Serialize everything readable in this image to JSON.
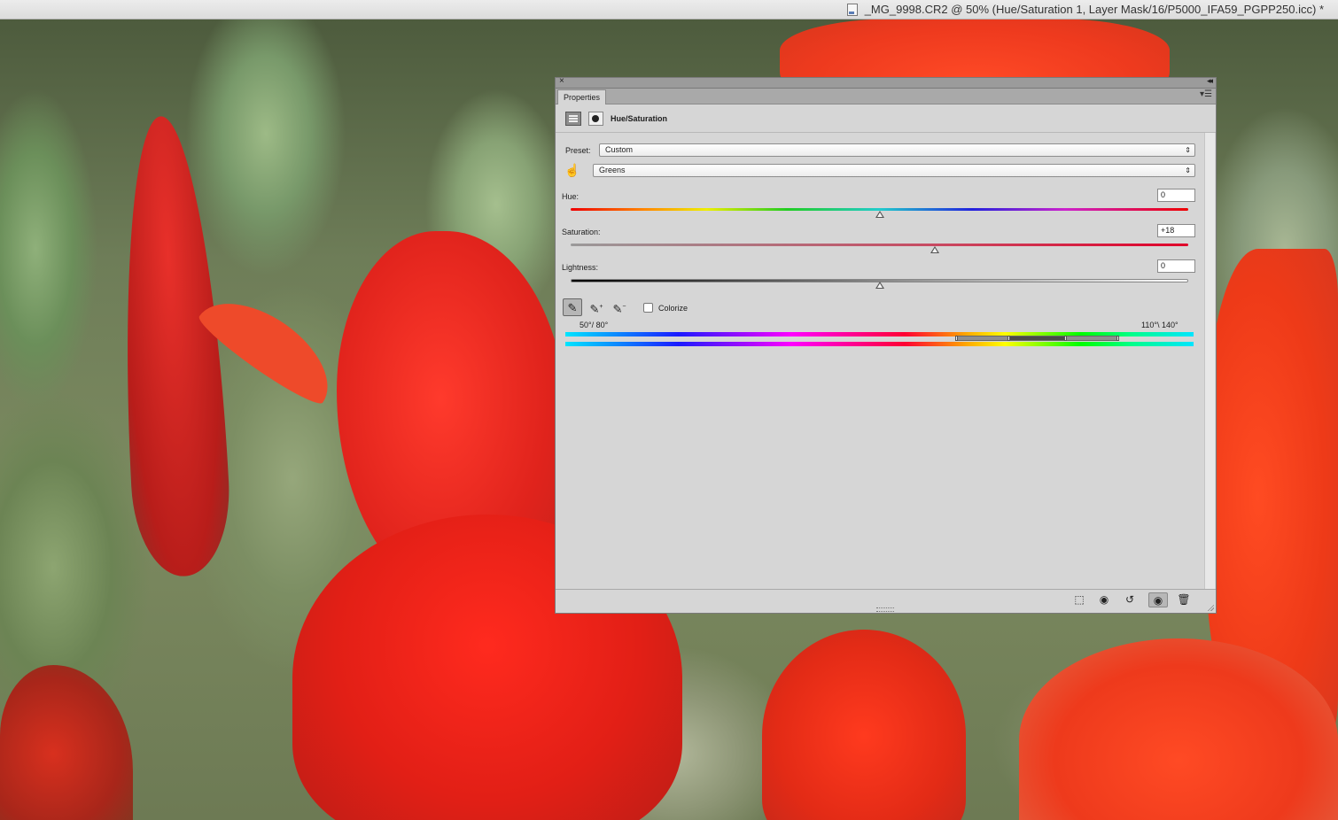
{
  "window": {
    "title": "_MG_9998.CR2 @ 50% (Hue/Saturation 1, Layer Mask/16/P5000_IFA59_PGPP250.icc) *"
  },
  "panel": {
    "tab_label": "Properties",
    "adjustment_title": "Hue/Saturation",
    "preset": {
      "label": "Preset:",
      "value": "Custom"
    },
    "channel": {
      "value": "Greens"
    },
    "hue": {
      "label": "Hue:",
      "value": "0",
      "level": 0.5
    },
    "saturation": {
      "label": "Saturation:",
      "value": "+18",
      "level": 0.59
    },
    "lightness": {
      "label": "Lightness:",
      "value": "0",
      "level": 0.5
    },
    "colorize": {
      "label": "Colorize",
      "checked": false
    },
    "range": {
      "left_label": "50°/ 80°",
      "right_label": "110°\\ 140°"
    }
  },
  "icons": {
    "close": "close-icon",
    "collapse": "collapse-icon",
    "menu": "panel-menu-icon",
    "targeted_adjust": "targeted-adjustment-hand-icon",
    "eyedropper": "eyedropper-icon",
    "eyedropper_add": "eyedropper-plus-icon",
    "eyedropper_sub": "eyedropper-minus-icon",
    "clip": "clip-to-layer-icon",
    "view_previous": "view-previous-state-icon",
    "reset": "reset-icon",
    "visibility": "eye-icon",
    "delete": "trash-icon"
  },
  "colors": {
    "panel_bg": "#d6d6d6",
    "titlebar_bg": "#e4e4e4",
    "accent_red": "#e00000"
  }
}
